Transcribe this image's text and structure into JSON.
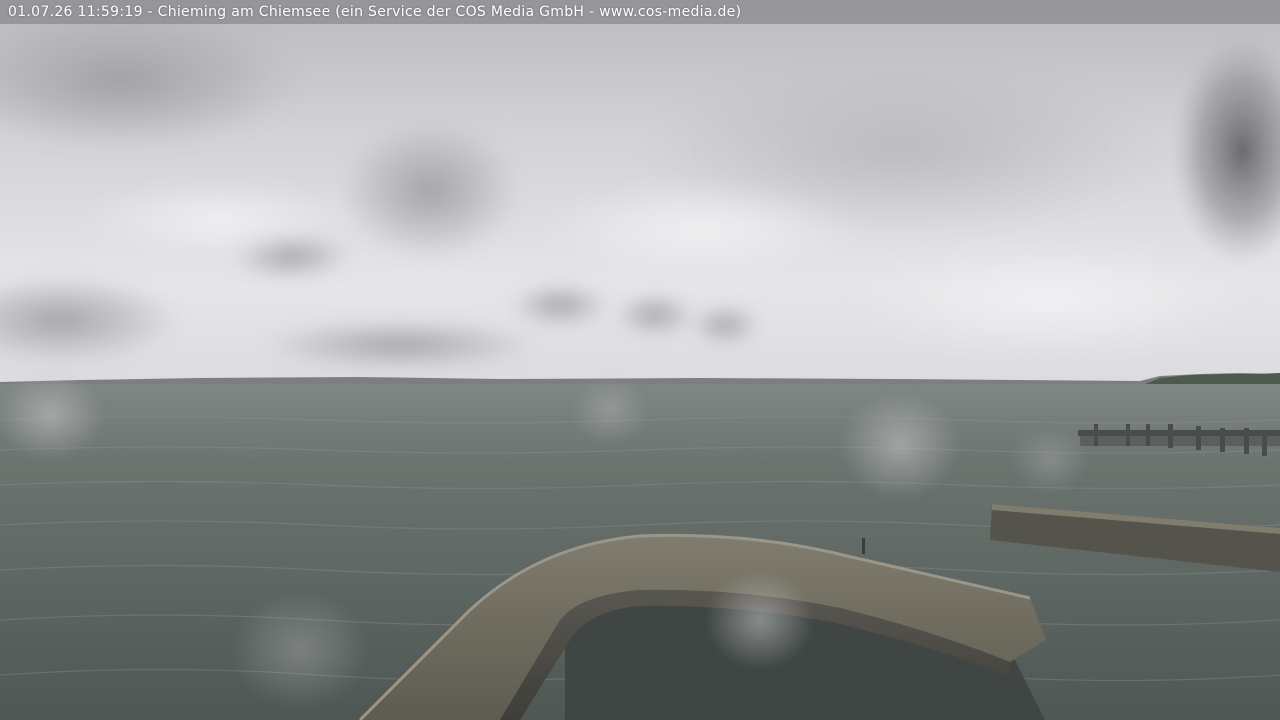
{
  "overlay": {
    "caption": "01.07.26  11:59:19 - Chieming am Chiemsee (ein Service der COS Media GmbH - www.cos-media.de)"
  },
  "scene": {
    "sky_color": "#d9d9dc",
    "water_color": "#5f6764",
    "wall_color": "#6b675a"
  }
}
